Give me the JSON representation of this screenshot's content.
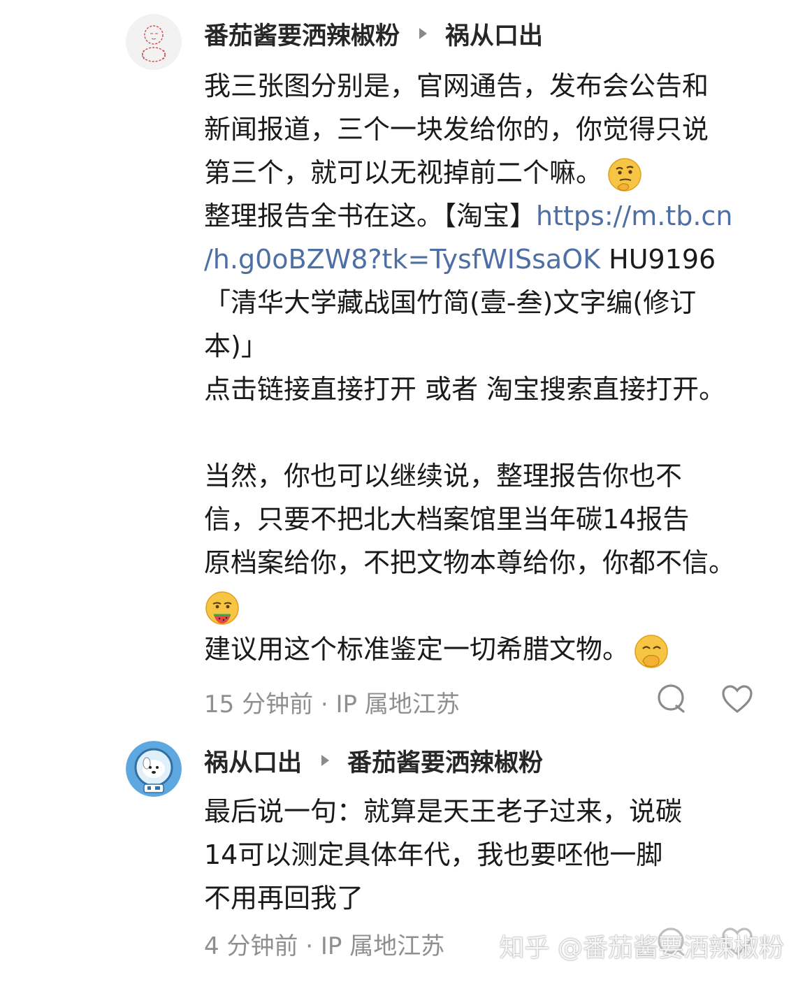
{
  "comments": [
    {
      "author": "番茄酱要洒辣椒粉",
      "reply_to": "祸从口出",
      "avatar_icon": "sketch-figure-avatar",
      "lines": [
        "我三张图分别是，官网通告，发布会公告和",
        "新闻报道，三个一块发给你的，你觉得只说",
        "第三个，就可以无视掉前二个嘛。",
        "整理报告全书在这。【淘宝】",
        "https://m.tb.cn",
        "/h.g0oBZW8?tk=TysfWISsaOK",
        " HU9196",
        "「清华大学藏战国竹简(壹-叁)文字编(修订",
        "本)」",
        "点击链接直接打开 或者 淘宝搜索直接打开。",
        "",
        "当然，你也可以继续说，整理报告你也不",
        "信，只要不把北大档案馆里当年碳14报告",
        "原档案给你，不把文物本尊给你，你都不信。",
        "建议用这个标准鉴定一切希腊文物。"
      ],
      "meta": "15 分钟前 · IP 属地江苏"
    },
    {
      "author": "祸从口出",
      "reply_to": "番茄酱要洒辣椒粉",
      "avatar_icon": "astronaut-dog-avatar",
      "lines": [
        "最后说一句：就算是天王老子过来，说碳",
        "14可以测定具体年代，我也要呸他一脚",
        "不用再回我了"
      ],
      "meta": "4 分钟前 · IP 属地江苏"
    }
  ],
  "watermark": "知乎 @番茄酱要洒辣椒粉",
  "colors": {
    "link": "#4d6fa3",
    "meta": "#8f8f8f",
    "text": "#1a1a1a"
  }
}
